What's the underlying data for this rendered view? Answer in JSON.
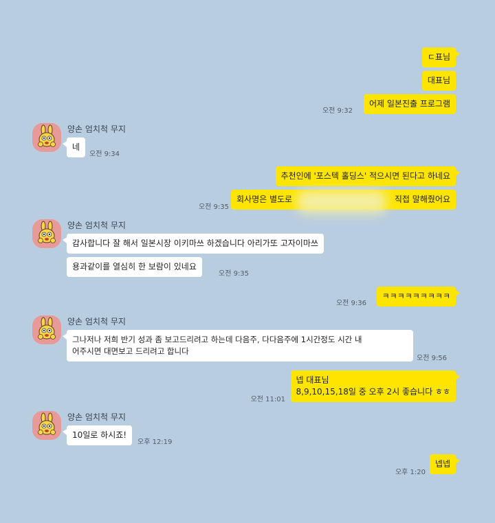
{
  "chat": {
    "accent_me": "#fee500",
    "accent_them": "#ffffff",
    "background": "#b9cde0",
    "avatar_icon": "rabbit-muzi-icon",
    "sender_name": "양손 엄치척 무지",
    "messages": {
      "m1": "ㄷ표님",
      "m2": "대표님",
      "m3": "어제 일본진출 프로그램",
      "t3": "오전 9:32",
      "r1": "네",
      "rt1": "오전 9:34",
      "m4": "추천인에 '포스텍 홀딩스' 적으시면 된다고 하네요",
      "m5_pre": "회사명은 별도로",
      "m5_post": "직접 말해줬어요",
      "t5": "오전 9:35",
      "r2": "감사합니다 잘 해서 일본시장 이키마쓰 하겠습니다 아리가또 고자이마쓰",
      "r3": "용과같이를 열심히 한 보람이 있네요",
      "rt3": "오전 9:35",
      "m6": "ㅋㅋㅋㅋㅋㅋㅋㅋㅋ",
      "t6": "오전 9:36",
      "r4_line1": "그나저나 저희 반기 성과 좀 보고드리려고 하는데 다음주, 다다음주에 1시간정도 시간 내",
      "r4_line2": "어주시면 대면보고 드리려고 합니다",
      "rt4": "오전 9:56",
      "m7_line1": "넵 대표님",
      "m7_line2": "8,9,10,15,18일 중 오후 2시 좋습니다 ㅎㅎ",
      "t7": "오전 11:01",
      "r5": "10일로 하시죠!",
      "rt5": "오후 12:19",
      "m8": "넵넵",
      "t8": "오후 1:20"
    }
  }
}
